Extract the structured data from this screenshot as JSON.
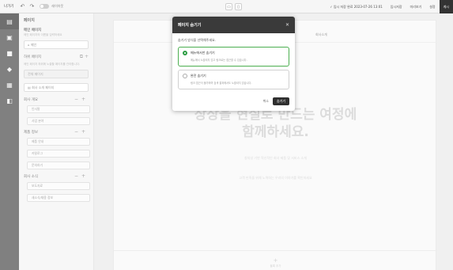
{
  "toolbar": {
    "exit": "나가기",
    "undo_icon": "undo-icon",
    "redo_icon": "redo-icon",
    "toggle_label": "레이아웃",
    "center_icon": "monitor-icon",
    "status": "✓ 임시 저장 완료 2023-07-26 13:01",
    "btn_temp": "임시저장",
    "btn_preview": "미리보기",
    "btn_settings": "설정",
    "btn_publish": "게시"
  },
  "rail": [
    "page-icon",
    "image-icon",
    "block-icon",
    "theme-icon",
    "layout-icon",
    "gallery-icon"
  ],
  "panel": {
    "title": "페이지",
    "main_page_title": "메인 페이지",
    "main_page_desc": "메인 페이지의 이름을 입력하세요",
    "main_page_value": "메인",
    "sub_page_title": "하위 페이지",
    "sub_page_desc": "메인 페이지 하위에 노출할 페이지를 관리합니다.",
    "dropdown_value": "전체 페이지",
    "link_item": "회사 소개 페이지",
    "sections": [
      {
        "title": "회사 개요",
        "items": [
          "인사말",
          "사업 분야"
        ]
      },
      {
        "title": "제품 정보",
        "items": [
          "제품 안내",
          "카탈로그",
          "문의하기"
        ]
      },
      {
        "title": "회사 소식",
        "items": [
          "보도자료",
          "새소식/채용 정보"
        ]
      }
    ]
  },
  "canvas": {
    "header_label": "회사소개",
    "headline_line1": "상상을 현실로 만드는 여정에",
    "headline_line2": "함께하세요.",
    "desc_line1": "창의성 기반 혁신적인 회사 제품 및 서비스 소개",
    "desc_line2": "고객 만족을 위해 노력하는 우리의 이야기를 확인하세요",
    "footer_plus": "+",
    "footer_text": "블록 추가"
  },
  "modal": {
    "title": "페이지 숨기기",
    "close_icon": "close-icon",
    "question": "숨기기 방식을 선택해주세요.",
    "options": [
      {
        "title": "메뉴에서만 숨기기",
        "desc": "메뉴에서 노출되지 않고 링크로는 접근할 수 있습니다.",
        "selected": true
      },
      {
        "title": "완전 숨기기",
        "desc": "링크 접근이 불가하며 검색 결과에서도 노출되지 않습니다.",
        "selected": false
      }
    ],
    "cancel": "취소",
    "confirm": "숨기기"
  },
  "colors": {
    "accent": "#2e9e45",
    "modal_header": "#3a3a3a",
    "rail": "#3c3c3c"
  }
}
